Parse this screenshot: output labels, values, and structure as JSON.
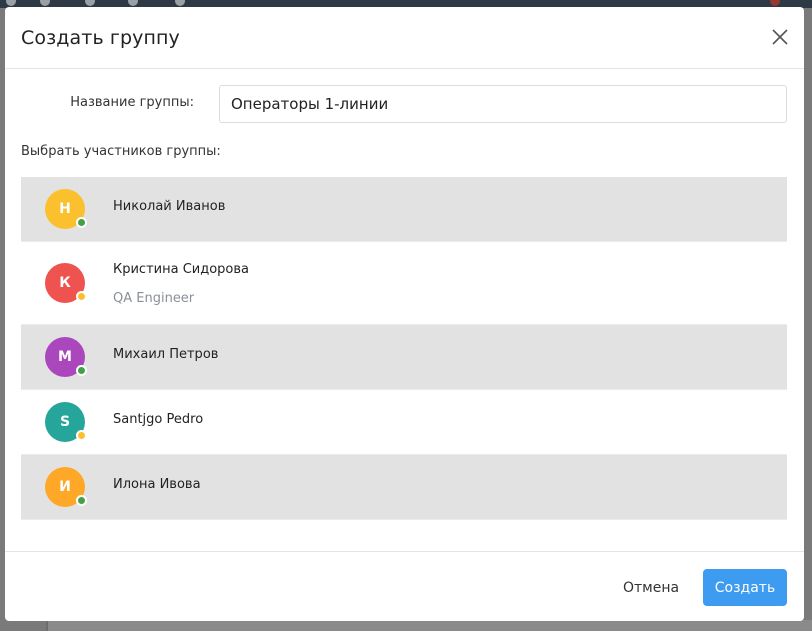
{
  "dialog": {
    "title": "Создать группу"
  },
  "form": {
    "name_label": "Название группы:",
    "name_value": "Операторы 1-линии",
    "members_label": "Выбрать участников группы:"
  },
  "members": [
    {
      "initial": "Н",
      "name": "Николай Иванов",
      "role": "",
      "avatar_color": "#fbc02d",
      "status_color": "#43a047",
      "selected": true
    },
    {
      "initial": "К",
      "name": "Кристина Сидорова",
      "role": "QA Engineer",
      "avatar_color": "#ef5350",
      "status_color": "#fbc02d",
      "selected": false
    },
    {
      "initial": "М",
      "name": "Михаил Петров",
      "role": "",
      "avatar_color": "#ab47bc",
      "status_color": "#43a047",
      "selected": true
    },
    {
      "initial": "S",
      "name": "Santjgo Pedro",
      "role": "",
      "avatar_color": "#26a69a",
      "status_color": "#fbc02d",
      "selected": false
    },
    {
      "initial": "И",
      "name": "Илона Ивова",
      "role": "",
      "avatar_color": "#ffa726",
      "status_color": "#43a047",
      "selected": true
    }
  ],
  "footer": {
    "cancel_label": "Отмена",
    "create_label": "Создать"
  },
  "colors": {
    "primary": "#3d9cf0",
    "selected_row": "#e2e2e2"
  }
}
